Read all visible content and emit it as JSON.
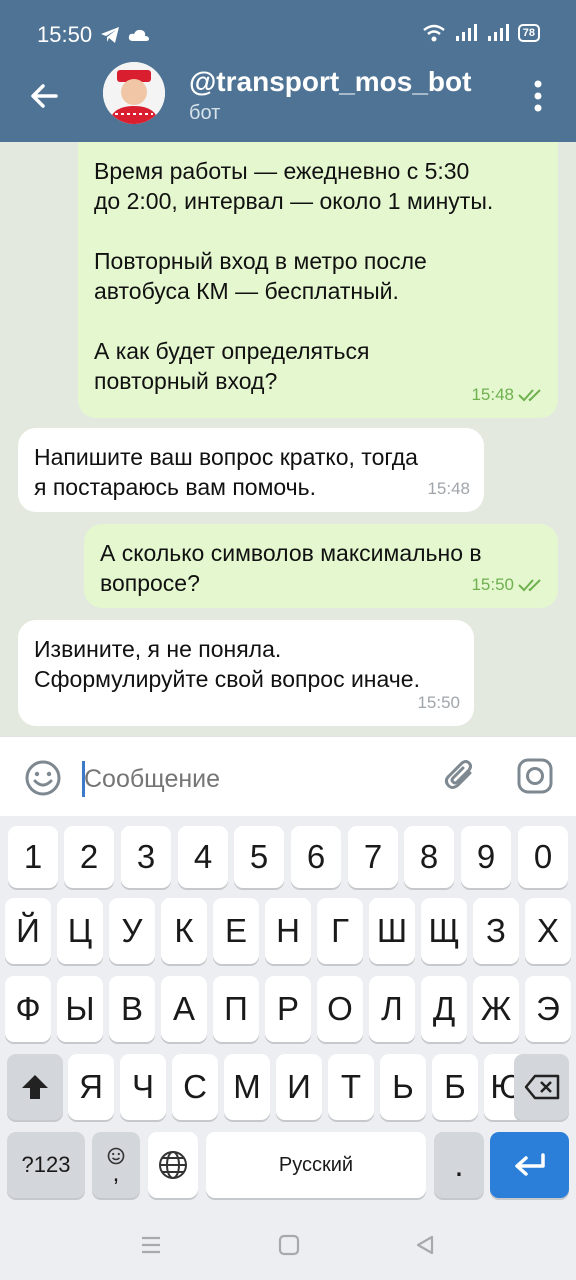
{
  "status": {
    "time": "15:50",
    "battery": "78"
  },
  "header": {
    "title": "@transport_mos_bot",
    "subtitle": "бот"
  },
  "messages": [
    {
      "dir": "out",
      "text": "Время работы — ежедневно с 5:30\nдо 2:00, интервал — около 1 минуты.\n\nПовторный вход в метро после\nавтобуса КМ — бесплатный.\n\nА как будет определяться\nповторный вход?",
      "time": "15:48",
      "read": true
    },
    {
      "dir": "in",
      "text": "Напишите ваш вопрос кратко, тогда\nя постараюсь вам помочь.",
      "time": "15:48"
    },
    {
      "dir": "out",
      "text": "А сколько символов максимально в\nвопросе?",
      "time": "15:50",
      "read": true
    },
    {
      "dir": "in",
      "text": "Извините, я не поняла.\nСформулируйте свой вопрос иначе.",
      "time": "15:50"
    }
  ],
  "input": {
    "placeholder": "Сообщение"
  },
  "keyboard": {
    "row_numbers": [
      "1",
      "2",
      "3",
      "4",
      "5",
      "6",
      "7",
      "8",
      "9",
      "0"
    ],
    "row1": [
      "Й",
      "Ц",
      "У",
      "К",
      "Е",
      "Н",
      "Г",
      "Ш",
      "Щ",
      "З",
      "Х"
    ],
    "row2": [
      "Ф",
      "Ы",
      "В",
      "А",
      "П",
      "Р",
      "О",
      "Л",
      "Д",
      "Ж",
      "Э"
    ],
    "row3": [
      "Я",
      "Ч",
      "С",
      "М",
      "И",
      "Т",
      "Ь",
      "Б",
      "Ю"
    ],
    "symbols_label": "?123",
    "emoji_comma_label": ",",
    "space_label": "Русский",
    "period_label": "."
  }
}
